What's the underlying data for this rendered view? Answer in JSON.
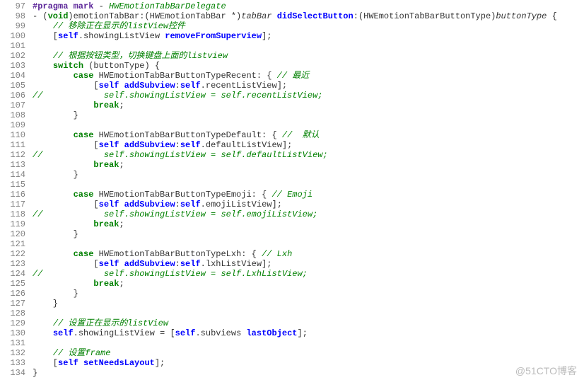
{
  "lineStart": 97,
  "lineEnd": 134,
  "watermark": "@51CTO博客",
  "lines": [
    [
      [
        "kw-preproc",
        "#pragma mark"
      ],
      [
        "plain",
        " - "
      ],
      [
        "comment",
        "HWEmotionTabBarDelegate"
      ]
    ],
    [
      [
        "plain",
        "- ("
      ],
      [
        "kw-void",
        "void"
      ],
      [
        "plain",
        ")emotionTabBar:(HWEmotionTabBar *)"
      ],
      [
        "type",
        "tabBar"
      ],
      [
        "plain",
        " "
      ],
      [
        "kw-msg",
        "didSelectButton"
      ],
      [
        "plain",
        ":(HWEmotionTabBarButtonType)"
      ],
      [
        "type",
        "buttonType"
      ],
      [
        "plain",
        " {"
      ]
    ],
    [
      [
        "plain",
        "    "
      ],
      [
        "comment",
        "// 移除正在显示的listView控件"
      ]
    ],
    [
      [
        "plain",
        "    ["
      ],
      [
        "kw-self",
        "self"
      ],
      [
        "plain",
        ".showingListView "
      ],
      [
        "kw-msg",
        "removeFromSuperview"
      ],
      [
        "plain",
        "];"
      ]
    ],
    [
      [
        "plain",
        ""
      ]
    ],
    [
      [
        "plain",
        "    "
      ],
      [
        "comment",
        "// 根据按钮类型，切换键盘上面的listview"
      ]
    ],
    [
      [
        "plain",
        "    "
      ],
      [
        "kw-void",
        "switch"
      ],
      [
        "plain",
        " (buttonType) {"
      ]
    ],
    [
      [
        "plain",
        "        "
      ],
      [
        "kw-void",
        "case"
      ],
      [
        "plain",
        " HWEmotionTabBarButtonTypeRecent: { "
      ],
      [
        "comment",
        "// 最近"
      ]
    ],
    [
      [
        "plain",
        "            ["
      ],
      [
        "kw-self",
        "self"
      ],
      [
        "plain",
        " "
      ],
      [
        "kw-msg",
        "addSubview"
      ],
      [
        "plain",
        ":"
      ],
      [
        "kw-self",
        "self"
      ],
      [
        "plain",
        ".recentListView];"
      ]
    ],
    [
      [
        "comment",
        "//            self.showingListView = self.recentListView;"
      ]
    ],
    [
      [
        "plain",
        "            "
      ],
      [
        "kw-void",
        "break"
      ],
      [
        "plain",
        ";"
      ]
    ],
    [
      [
        "plain",
        "        }"
      ]
    ],
    [
      [
        "plain",
        ""
      ]
    ],
    [
      [
        "plain",
        "        "
      ],
      [
        "kw-void",
        "case"
      ],
      [
        "plain",
        " HWEmotionTabBarButtonTypeDefault: { "
      ],
      [
        "comment",
        "//  默认"
      ]
    ],
    [
      [
        "plain",
        "            ["
      ],
      [
        "kw-self",
        "self"
      ],
      [
        "plain",
        " "
      ],
      [
        "kw-msg",
        "addSubview"
      ],
      [
        "plain",
        ":"
      ],
      [
        "kw-self",
        "self"
      ],
      [
        "plain",
        ".defaultListView];"
      ]
    ],
    [
      [
        "comment",
        "//            self.showingListView = self.defaultListView;"
      ]
    ],
    [
      [
        "plain",
        "            "
      ],
      [
        "kw-void",
        "break"
      ],
      [
        "plain",
        ";"
      ]
    ],
    [
      [
        "plain",
        "        }"
      ]
    ],
    [
      [
        "plain",
        ""
      ]
    ],
    [
      [
        "plain",
        "        "
      ],
      [
        "kw-void",
        "case"
      ],
      [
        "plain",
        " HWEmotionTabBarButtonTypeEmoji: { "
      ],
      [
        "comment",
        "// Emoji"
      ]
    ],
    [
      [
        "plain",
        "            ["
      ],
      [
        "kw-self",
        "self"
      ],
      [
        "plain",
        " "
      ],
      [
        "kw-msg",
        "addSubview"
      ],
      [
        "plain",
        ":"
      ],
      [
        "kw-self",
        "self"
      ],
      [
        "plain",
        ".emojiListView];"
      ]
    ],
    [
      [
        "comment",
        "//            self.showingListView = self.emojiListView;"
      ]
    ],
    [
      [
        "plain",
        "            "
      ],
      [
        "kw-void",
        "break"
      ],
      [
        "plain",
        ";"
      ]
    ],
    [
      [
        "plain",
        "        }"
      ]
    ],
    [
      [
        "plain",
        ""
      ]
    ],
    [
      [
        "plain",
        "        "
      ],
      [
        "kw-void",
        "case"
      ],
      [
        "plain",
        " HWEmotionTabBarButtonTypeLxh: { "
      ],
      [
        "comment",
        "// Lxh"
      ]
    ],
    [
      [
        "plain",
        "            ["
      ],
      [
        "kw-self",
        "self"
      ],
      [
        "plain",
        " "
      ],
      [
        "kw-msg",
        "addSubview"
      ],
      [
        "plain",
        ":"
      ],
      [
        "kw-self",
        "self"
      ],
      [
        "plain",
        ".lxhListView];"
      ]
    ],
    [
      [
        "comment",
        "//            self.showingListView = self.LxhListView;"
      ]
    ],
    [
      [
        "plain",
        "            "
      ],
      [
        "kw-void",
        "break"
      ],
      [
        "plain",
        ";"
      ]
    ],
    [
      [
        "plain",
        "        }"
      ]
    ],
    [
      [
        "plain",
        "    }"
      ]
    ],
    [
      [
        "plain",
        ""
      ]
    ],
    [
      [
        "plain",
        "    "
      ],
      [
        "comment",
        "// 设置正在显示的listView"
      ]
    ],
    [
      [
        "plain",
        "    "
      ],
      [
        "kw-self",
        "self"
      ],
      [
        "plain",
        ".showingListView = ["
      ],
      [
        "kw-self",
        "self"
      ],
      [
        "plain",
        ".subviews "
      ],
      [
        "kw-msg",
        "lastObject"
      ],
      [
        "plain",
        "];"
      ]
    ],
    [
      [
        "plain",
        ""
      ]
    ],
    [
      [
        "plain",
        "    "
      ],
      [
        "comment",
        "// 设置frame"
      ]
    ],
    [
      [
        "plain",
        "    ["
      ],
      [
        "kw-self",
        "self"
      ],
      [
        "plain",
        " "
      ],
      [
        "kw-msg",
        "setNeedsLayout"
      ],
      [
        "plain",
        "];"
      ]
    ],
    [
      [
        "plain",
        "}"
      ]
    ]
  ]
}
